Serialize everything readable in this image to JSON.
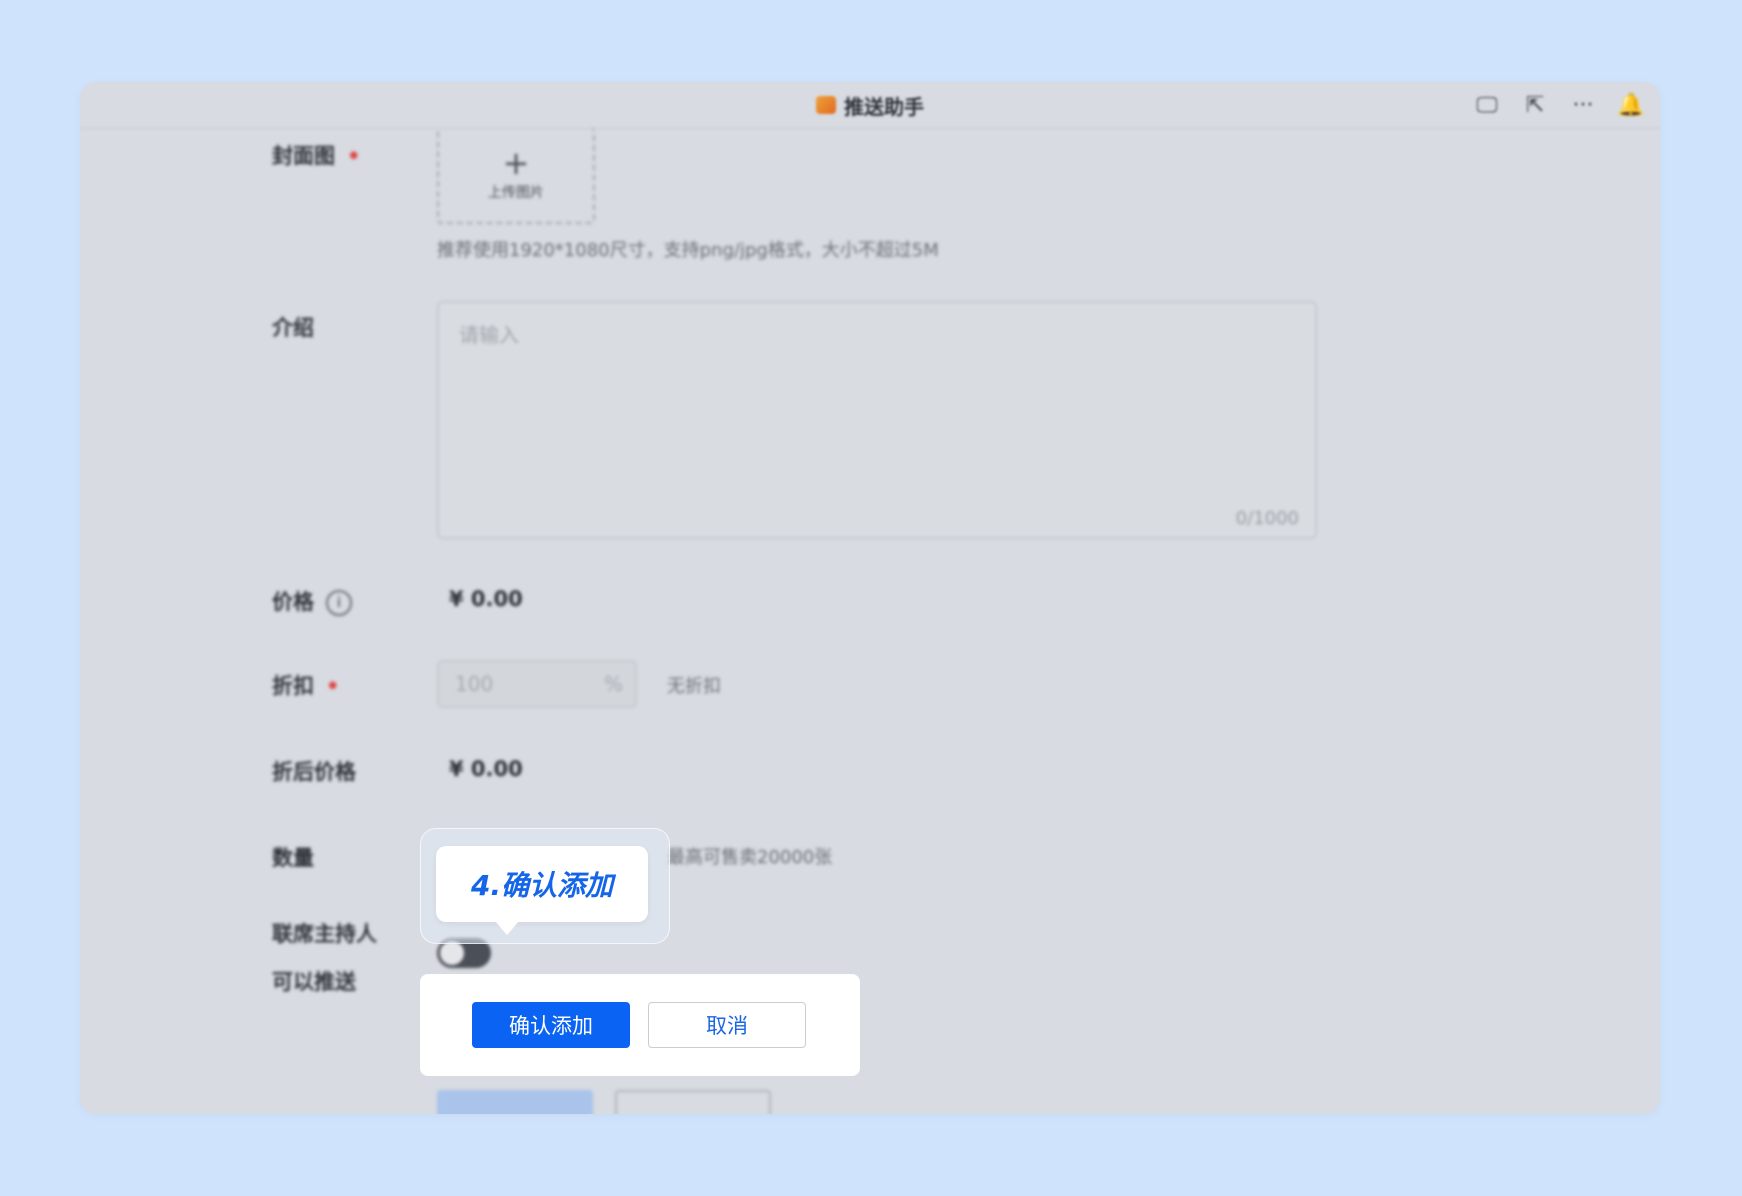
{
  "window": {
    "title": "推送助手",
    "actions": [
      {
        "name": "screen-icon",
        "glyph": "🖵"
      },
      {
        "name": "open-external-icon",
        "glyph": "⇱"
      },
      {
        "name": "more-icon",
        "glyph": "···"
      },
      {
        "name": "pin-icon",
        "glyph": "🔔"
      }
    ]
  },
  "form": {
    "cover_label": "封面图",
    "required_mark": "•",
    "upload_plus": "+",
    "upload_text": "上传图片",
    "cover_hint": "推荐使用1920*1080尺寸，支持png/jpg格式，大小不超过5M",
    "intro_label": "介绍",
    "intro_placeholder": "请输入",
    "intro_count": "0/1000",
    "price_label": "价格",
    "price_info_glyph": "i",
    "price_value": "¥ 0.00",
    "discount_label": "折扣",
    "discount_placeholder": "100",
    "discount_unit": "%",
    "discount_hint": "无折扣",
    "final_price_label": "折后价格",
    "final_price_value": "¥ 0.00",
    "quantity_label": "数量",
    "quantity_hint": "最高可售卖20000张",
    "cohost_label_line1": "联席主持人",
    "cohost_label_line2": "可以推送",
    "bg_confirm_label": "确认添加",
    "bg_cancel_label": "取消"
  },
  "tooltip": {
    "text": "4.确认添加"
  },
  "actions": {
    "confirm_label": "确认添加",
    "cancel_label": "取消"
  },
  "colors": {
    "background": "#cfe3fd",
    "primary": "#0a63f3",
    "tooltip_text": "#1565e9"
  }
}
